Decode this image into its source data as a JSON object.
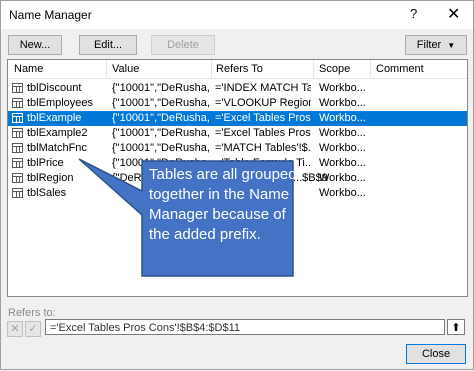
{
  "window": {
    "title": "Name Manager",
    "help": "?",
    "close": "✕"
  },
  "toolbar": {
    "new_label": "New...",
    "edit_label": "Edit...",
    "delete_label": "Delete",
    "filter_label": "Filter"
  },
  "list": {
    "columns": [
      "Name",
      "Value",
      "Refers To",
      "Scope",
      "Comment"
    ],
    "rows": [
      {
        "name": "tblDiscount",
        "value": "{\"10001\",\"DeRusha,...",
        "refers": "='INDEX MATCH Ta...",
        "scope": "Workbo..."
      },
      {
        "name": "tblEmployees",
        "value": "{\"10001\",\"DeRusha,...",
        "refers": "='VLOOKUP Region...",
        "scope": "Workbo..."
      },
      {
        "name": "tblExample",
        "value": "{\"10001\",\"DeRusha,...",
        "refers": "='Excel Tables Pros ...",
        "scope": "Workbo..."
      },
      {
        "name": "tblExample2",
        "value": "{\"10001\",\"DeRusha,...",
        "refers": "='Excel Tables Pros ...",
        "scope": "Workbo..."
      },
      {
        "name": "tblMatchFnc",
        "value": "{\"10001\",\"DeRusha,...",
        "refers": "='MATCH Tables'!$...",
        "scope": "Workbo..."
      },
      {
        "name": "tblPrice",
        "value": "{\"10001\",\"DeRusha,...",
        "refers": "='Table Formula Ti...",
        "scope": "Workbo..."
      },
      {
        "name": "tblRegion",
        "value": "{\"DeRu...",
        "refers": "...$B$9",
        "scope": "Workbo..."
      },
      {
        "name": "tblSales",
        "value": "",
        "refers": "",
        "scope": "Workbo..."
      }
    ],
    "selected_index": 2
  },
  "callout": {
    "text": "Tables are all grouped together in the Name Manager because of the added prefix.",
    "fill": "#4472c4",
    "stroke": "#2f528f"
  },
  "refers_to": {
    "label": "Refers to:",
    "value": "='Excel Tables Pros Cons'!$B$4:$D$11",
    "cancel_icon": "✕",
    "confirm_icon": "✓",
    "collapse_icon": "⬆"
  },
  "footer": {
    "close_label": "Close"
  },
  "colors": {
    "selection": "#0078d7"
  }
}
